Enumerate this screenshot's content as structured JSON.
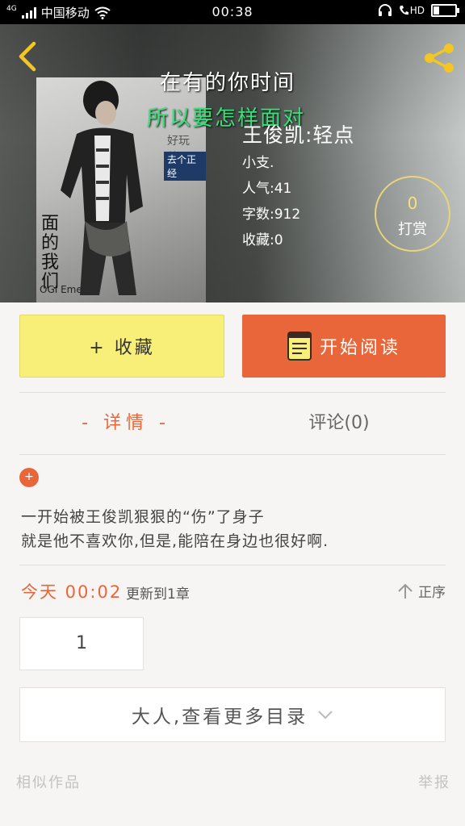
{
  "status_bar": {
    "network": "4G",
    "carrier": "中国移动",
    "time": "00:38",
    "hd_label": "HD"
  },
  "header": {
    "overlay_line1": "在有的你时间",
    "overlay_line2": "所以要怎样面对",
    "book_title": "王俊凯:轻点",
    "author": "小支.",
    "popularity": "人气:41",
    "word_count": "字数:912",
    "favorites": "收藏:0",
    "reward_count": "0",
    "reward_label": "打赏",
    "cover_caption_1": "好玩儿?",
    "cover_caption_2": "去个正经",
    "cover_caption_3": "面的我们",
    "cover_caption_4": "OGI Eme"
  },
  "actions": {
    "favorite_label": "+ 收藏",
    "read_label": "开始阅读"
  },
  "tabs": {
    "details": "- 详情 -",
    "comments": "评论(0)"
  },
  "description": {
    "badge": "+",
    "line1": "一开始被王俊凯狠狠的“伤”了身子",
    "line2": "就是他不喜欢你,但是,能陪在身边也很好啊."
  },
  "update": {
    "today": "今天 00:02",
    "text": "更新到1章",
    "sort_label": "正序"
  },
  "chapters": {
    "first": "1",
    "more_label": "大人,查看更多目录"
  },
  "footer": {
    "similar": "相似作品",
    "report": "举报"
  },
  "colors": {
    "accent": "#e8663a",
    "favorite_bg": "#f7ef78",
    "reward_ring": "#e8d47a",
    "overlay_green": "#39e07a"
  }
}
